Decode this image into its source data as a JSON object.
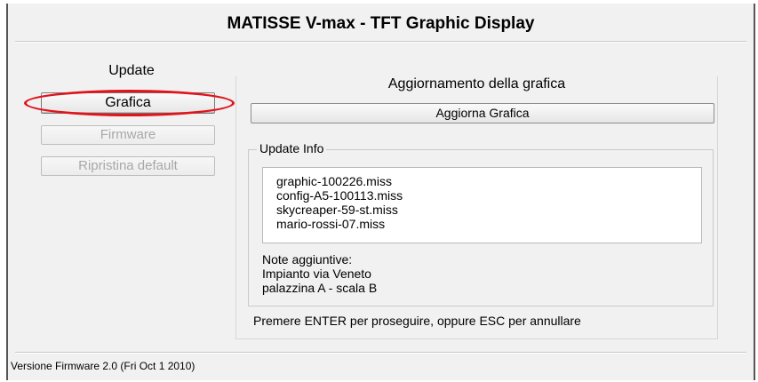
{
  "window": {
    "title": "MATISSE V-max - TFT Graphic Display"
  },
  "left_panel": {
    "group_label": "Update",
    "buttons": [
      {
        "label": "Grafica",
        "state": "active"
      },
      {
        "label": "Firmware",
        "state": "disabled"
      },
      {
        "label": "Ripristina default",
        "state": "disabled"
      }
    ],
    "highlight_color": "#e0141b"
  },
  "right_panel": {
    "heading": "Aggiornamento della grafica",
    "action_button": "Aggiorna Grafica",
    "update_info": {
      "legend": "Update Info",
      "files": [
        "graphic-100226.miss",
        "config-A5-100113.miss",
        "skycreaper-59-st.miss",
        "mario-rossi-07.miss"
      ],
      "notes": [
        "Note aggiuntive:",
        "Impianto via Veneto",
        "palazzina A - scala B"
      ]
    },
    "prompt": "Premere ENTER per proseguire, oppure ESC per annullare"
  },
  "footer": {
    "firmware_version": "Versione Firmware 2.0 (Fri Oct 1 2010)"
  }
}
